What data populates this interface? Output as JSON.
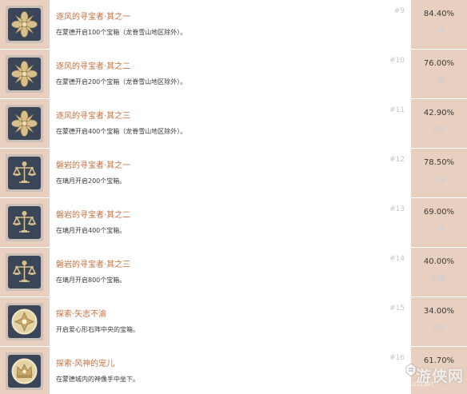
{
  "achievements": [
    {
      "title": "逐风的寻宝者·其之一",
      "desc": "在蒙德开启100个宝箱（龙脊雪山地区除外）。",
      "num": "#9",
      "pct": "84.40%",
      "rarity": "一般",
      "icon": "windwheel-icon"
    },
    {
      "title": "逐风的寻宝者·其之二",
      "desc": "在蒙德开启200个宝箱（龙脊雪山地区除外）。",
      "num": "#10",
      "pct": "76.00%",
      "rarity": "一般",
      "icon": "windwheel-icon"
    },
    {
      "title": "逐风的寻宝者·其之三",
      "desc": "在蒙德开启400个宝箱（龙脊雪山地区除外）。",
      "num": "#11",
      "pct": "42.90%",
      "rarity": "较难",
      "icon": "windwheel-icon"
    },
    {
      "title": "磐岩的寻宝者·其之一",
      "desc": "在璃月开启200个宝箱。",
      "num": "#12",
      "pct": "78.50%",
      "rarity": "一般",
      "icon": "scales-icon"
    },
    {
      "title": "磐岩的寻宝者·其之二",
      "desc": "在璃月开启400个宝箱。",
      "num": "#13",
      "pct": "69.00%",
      "rarity": "一般",
      "icon": "scales-icon"
    },
    {
      "title": "磐岩的寻宝者·其之三",
      "desc": "在璃月开启800个宝箱。",
      "num": "#14",
      "pct": "40.00%",
      "rarity": "较难",
      "icon": "scales-icon"
    },
    {
      "title": "探索·矢志不渝",
      "desc": "开启爱心形石阵中央的宝箱。",
      "num": "#15",
      "pct": "34.00%",
      "rarity": "较难",
      "icon": "star-emblem-icon"
    },
    {
      "title": "探索·风神的宠儿",
      "desc": "在蒙德城内的神像手中坐下。",
      "num": "#16",
      "pct": "61.70%",
      "rarity": "一般",
      "icon": "crown-emblem-icon"
    }
  ],
  "watermark": {
    "text": "游侠网",
    "sub": "ALI213.NET"
  },
  "colors": {
    "title": "#c1703f",
    "side_bg": "#e8cfbf",
    "icon_bg": "#3a4558",
    "gold": "#d9c08a"
  }
}
